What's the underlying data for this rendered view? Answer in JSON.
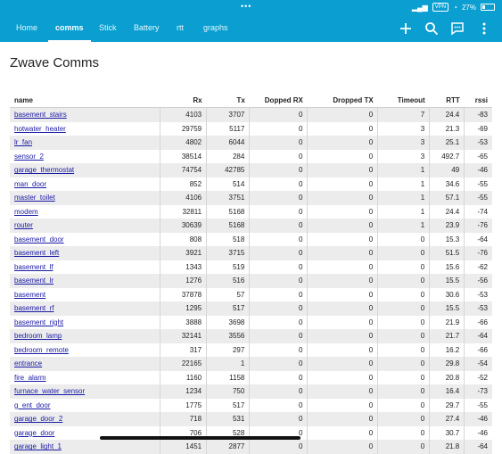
{
  "status": {
    "dots": "•••",
    "vpn": "VPN",
    "battery": "27%"
  },
  "tabs": [
    {
      "label": "Home",
      "active": false
    },
    {
      "label": "comms",
      "active": true
    },
    {
      "label": "Stick",
      "active": false
    },
    {
      "label": "Battery",
      "active": false
    },
    {
      "label": "rtt",
      "active": false
    },
    {
      "label": "graphs",
      "active": false
    }
  ],
  "toolbar_icons": [
    "add-icon",
    "search-icon",
    "message-icon",
    "more-vert-icon"
  ],
  "title": "Zwave Comms",
  "table": {
    "headers": [
      "name",
      "Rx",
      "Tx",
      "Dopped RX",
      "Dropped TX",
      "Timeout",
      "RTT",
      "rssi"
    ],
    "rows": [
      [
        "basement_stairs",
        "4103",
        "3707",
        "0",
        "0",
        "7",
        "24.4",
        "-83"
      ],
      [
        "hotwater_heater",
        "29759",
        "5117",
        "0",
        "0",
        "3",
        "21.3",
        "-69"
      ],
      [
        "lr_fan",
        "4802",
        "6044",
        "0",
        "0",
        "3",
        "25.1",
        "-53"
      ],
      [
        "sensor_2",
        "38514",
        "284",
        "0",
        "0",
        "3",
        "492.7",
        "-65"
      ],
      [
        "garage_thermostat",
        "74754",
        "42785",
        "0",
        "0",
        "1",
        "49",
        "-46"
      ],
      [
        "man_door",
        "852",
        "514",
        "0",
        "0",
        "1",
        "34.6",
        "-55"
      ],
      [
        "master_toilet",
        "4106",
        "3751",
        "0",
        "0",
        "1",
        "57.1",
        "-55"
      ],
      [
        "modem",
        "32811",
        "5168",
        "0",
        "0",
        "1",
        "24.4",
        "-74"
      ],
      [
        "router",
        "30639",
        "5168",
        "0",
        "0",
        "1",
        "23.9",
        "-76"
      ],
      [
        "basement_door",
        "808",
        "518",
        "0",
        "0",
        "0",
        "15.3",
        "-64"
      ],
      [
        "basement_left",
        "3921",
        "3715",
        "0",
        "0",
        "0",
        "51.5",
        "-76"
      ],
      [
        "basement_lf",
        "1343",
        "519",
        "0",
        "0",
        "0",
        "15.6",
        "-62"
      ],
      [
        "basement_lr",
        "1276",
        "516",
        "0",
        "0",
        "0",
        "15.5",
        "-56"
      ],
      [
        "basement",
        "37878",
        "57",
        "0",
        "0",
        "0",
        "30.6",
        "-53"
      ],
      [
        "basement_rf",
        "1295",
        "517",
        "0",
        "0",
        "0",
        "15.5",
        "-53"
      ],
      [
        "basement_right",
        "3888",
        "3698",
        "0",
        "0",
        "0",
        "21.9",
        "-66"
      ],
      [
        "bedroom_lamp",
        "32141",
        "3556",
        "0",
        "0",
        "0",
        "21.7",
        "-64"
      ],
      [
        "bedroom_remote",
        "317",
        "297",
        "0",
        "0",
        "0",
        "16.2",
        "-66"
      ],
      [
        "entrance",
        "22165",
        "1",
        "0",
        "0",
        "0",
        "29.8",
        "-54"
      ],
      [
        "fire_alarm",
        "1160",
        "1158",
        "0",
        "0",
        "0",
        "20.8",
        "-52"
      ],
      [
        "furnace_water_sensor",
        "1234",
        "750",
        "0",
        "0",
        "0",
        "16.4",
        "-73"
      ],
      [
        "g_ent_door",
        "1775",
        "517",
        "0",
        "0",
        "0",
        "29.7",
        "-55"
      ],
      [
        "garage_door_2",
        "718",
        "531",
        "0",
        "0",
        "0",
        "27.4",
        "-46"
      ],
      [
        "garage_door",
        "706",
        "528",
        "0",
        "0",
        "0",
        "30.7",
        "-46"
      ],
      [
        "garage_light_1",
        "1451",
        "2877",
        "0",
        "0",
        "0",
        "21.8",
        "-64"
      ]
    ]
  }
}
